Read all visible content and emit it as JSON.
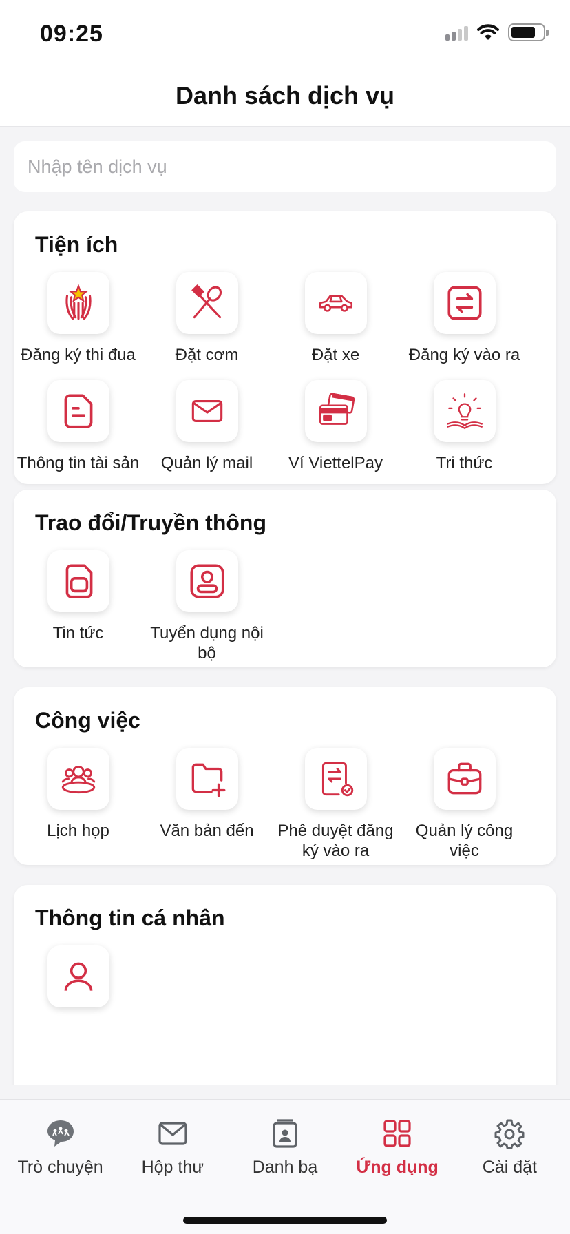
{
  "status_bar": {
    "time": "09:25"
  },
  "header": {
    "title": "Danh sách dịch vụ"
  },
  "search": {
    "placeholder": "Nhập tên dịch vụ"
  },
  "colors": {
    "accent": "#d32f45",
    "background": "#f4f4f6",
    "card": "#ffffff"
  },
  "sections": [
    {
      "title": "Tiện ích",
      "items": [
        {
          "label": "Đăng ký thi đua",
          "icon": "emblem-icon"
        },
        {
          "label": "Đặt cơm",
          "icon": "cutlery-icon"
        },
        {
          "label": "Đặt xe",
          "icon": "car-icon"
        },
        {
          "label": "Đăng ký vào ra",
          "icon": "swap-arrows-icon"
        },
        {
          "label": "Thông tin tài sản",
          "icon": "document-icon"
        },
        {
          "label": "Quản lý mail",
          "icon": "mail-icon"
        },
        {
          "label": "Ví ViettelPay",
          "icon": "cards-icon"
        },
        {
          "label": "Tri thức",
          "icon": "lightbulb-book-icon"
        }
      ]
    },
    {
      "title": "Trao đổi/Truyền thông",
      "items": [
        {
          "label": "Tin tức",
          "icon": "news-icon"
        },
        {
          "label": "Tuyển dụng nội bộ",
          "icon": "profile-card-icon"
        }
      ]
    },
    {
      "title": "Công việc",
      "items": [
        {
          "label": "Lịch họp",
          "icon": "meeting-icon"
        },
        {
          "label": "Văn bản đến",
          "icon": "folder-add-icon"
        },
        {
          "label": "Phê duyệt đăng ký vào ra",
          "icon": "approve-document-icon"
        },
        {
          "label": "Quản lý công việc",
          "icon": "briefcase-icon"
        }
      ]
    },
    {
      "title": "Thông tin cá nhân",
      "items": []
    }
  ],
  "tabbar": {
    "tabs": [
      {
        "label": "Trò chuyện",
        "icon": "chat-icon",
        "active": false
      },
      {
        "label": "Hộp thư",
        "icon": "mail-icon",
        "active": false
      },
      {
        "label": "Danh bạ",
        "icon": "contacts-icon",
        "active": false
      },
      {
        "label": "Ứng dụng",
        "icon": "apps-grid-icon",
        "active": true
      },
      {
        "label": "Cài đặt",
        "icon": "settings-gear-icon",
        "active": false
      }
    ]
  }
}
